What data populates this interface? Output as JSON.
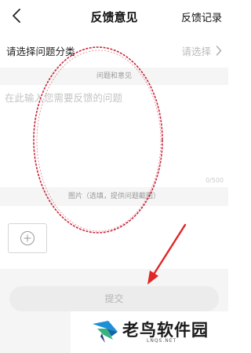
{
  "header": {
    "title": "反馈意见",
    "record_label": "反馈记录"
  },
  "category": {
    "label": "请选择问题分类",
    "value_placeholder": "请选择"
  },
  "description": {
    "section_label": "问题和意见",
    "placeholder": "在此输入您需要反馈的问题",
    "counter": "0/500"
  },
  "images": {
    "section_label": "图片（选填，提供问题截图）"
  },
  "submit": {
    "label": "提交"
  },
  "annotation": {
    "ellipse_color": "#c8283c",
    "arrow_color": "#e02626"
  },
  "watermark": {
    "name": "老鸟软件园",
    "url": "LNQS.NET",
    "icon": "bird-logo-icon"
  },
  "colors": {
    "background": "#ffffff",
    "section_gray": "#f5f5f5",
    "placeholder": "#c4c4c4",
    "submit_disabled": "#ececec"
  }
}
